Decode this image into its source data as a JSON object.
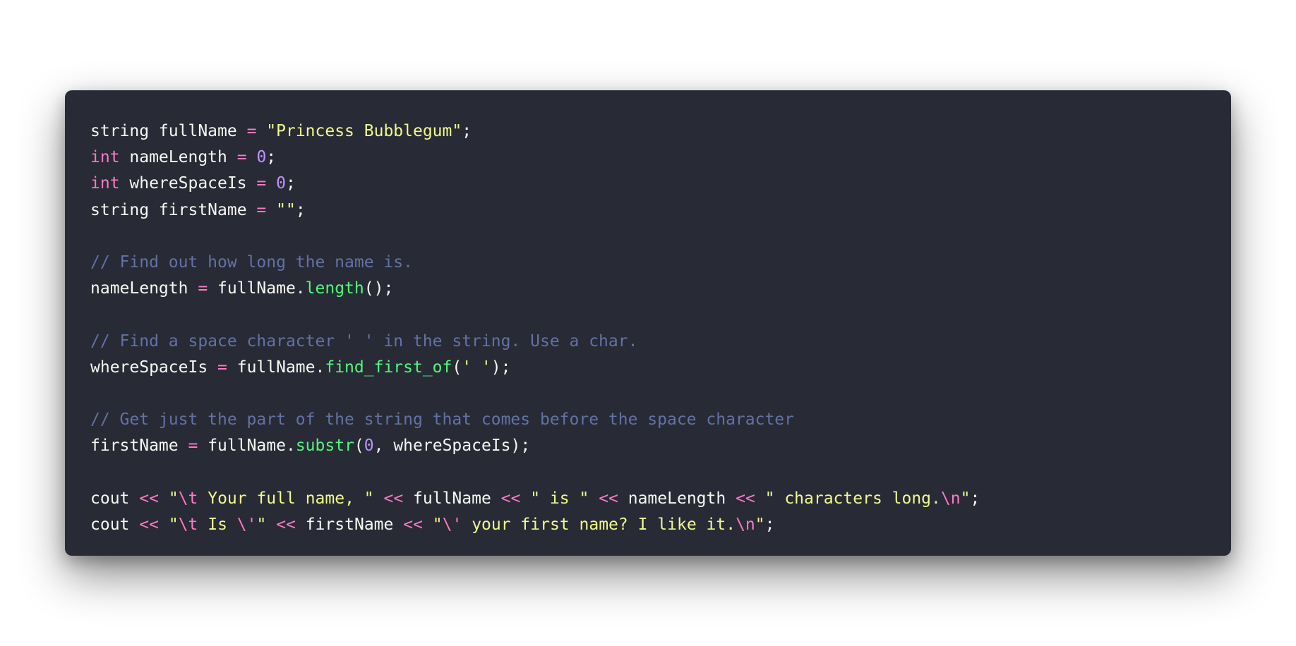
{
  "colors": {
    "background": "#ffffff",
    "editor_background": "#282a36",
    "plain": "#f8f8f2",
    "keyword": "#ff79c6",
    "operator": "#ff79c6",
    "string": "#f1fa8c",
    "escape": "#ff79c6",
    "number": "#bd93f9",
    "comment": "#6272a4",
    "function": "#50fa7b"
  },
  "code": {
    "language": "cpp",
    "lines": [
      [
        {
          "t": "plain",
          "v": "string fullName "
        },
        {
          "t": "op",
          "v": "="
        },
        {
          "t": "plain",
          "v": " "
        },
        {
          "t": "string",
          "v": "\"Princess Bubblegum\""
        },
        {
          "t": "plain",
          "v": ";"
        }
      ],
      [
        {
          "t": "keyword",
          "v": "int"
        },
        {
          "t": "plain",
          "v": " nameLength "
        },
        {
          "t": "op",
          "v": "="
        },
        {
          "t": "plain",
          "v": " "
        },
        {
          "t": "number",
          "v": "0"
        },
        {
          "t": "plain",
          "v": ";"
        }
      ],
      [
        {
          "t": "keyword",
          "v": "int"
        },
        {
          "t": "plain",
          "v": " whereSpaceIs "
        },
        {
          "t": "op",
          "v": "="
        },
        {
          "t": "plain",
          "v": " "
        },
        {
          "t": "number",
          "v": "0"
        },
        {
          "t": "plain",
          "v": ";"
        }
      ],
      [
        {
          "t": "plain",
          "v": "string firstName "
        },
        {
          "t": "op",
          "v": "="
        },
        {
          "t": "plain",
          "v": " "
        },
        {
          "t": "string",
          "v": "\"\""
        },
        {
          "t": "plain",
          "v": ";"
        }
      ],
      [],
      [
        {
          "t": "comment",
          "v": "// Find out how long the name is."
        }
      ],
      [
        {
          "t": "plain",
          "v": "nameLength "
        },
        {
          "t": "op",
          "v": "="
        },
        {
          "t": "plain",
          "v": " fullName."
        },
        {
          "t": "func",
          "v": "length"
        },
        {
          "t": "plain",
          "v": "();"
        }
      ],
      [],
      [
        {
          "t": "comment",
          "v": "// Find a space character ' ' in the string. Use a char."
        }
      ],
      [
        {
          "t": "plain",
          "v": "whereSpaceIs "
        },
        {
          "t": "op",
          "v": "="
        },
        {
          "t": "plain",
          "v": " fullName."
        },
        {
          "t": "func",
          "v": "find_first_of"
        },
        {
          "t": "plain",
          "v": "("
        },
        {
          "t": "string",
          "v": "' '"
        },
        {
          "t": "plain",
          "v": ");"
        }
      ],
      [],
      [
        {
          "t": "comment",
          "v": "// Get just the part of the string that comes before the space character"
        }
      ],
      [
        {
          "t": "plain",
          "v": "firstName "
        },
        {
          "t": "op",
          "v": "="
        },
        {
          "t": "plain",
          "v": " fullName."
        },
        {
          "t": "func",
          "v": "substr"
        },
        {
          "t": "plain",
          "v": "("
        },
        {
          "t": "number",
          "v": "0"
        },
        {
          "t": "plain",
          "v": ", whereSpaceIs);"
        }
      ],
      [],
      [
        {
          "t": "plain",
          "v": "cout "
        },
        {
          "t": "op",
          "v": "<<"
        },
        {
          "t": "plain",
          "v": " "
        },
        {
          "t": "string",
          "v": "\""
        },
        {
          "t": "escape",
          "v": "\\t"
        },
        {
          "t": "string",
          "v": " Your full name, \""
        },
        {
          "t": "plain",
          "v": " "
        },
        {
          "t": "op",
          "v": "<<"
        },
        {
          "t": "plain",
          "v": " fullName "
        },
        {
          "t": "op",
          "v": "<<"
        },
        {
          "t": "plain",
          "v": " "
        },
        {
          "t": "string",
          "v": "\" is \""
        },
        {
          "t": "plain",
          "v": " "
        },
        {
          "t": "op",
          "v": "<<"
        },
        {
          "t": "plain",
          "v": " nameLength "
        },
        {
          "t": "op",
          "v": "<<"
        },
        {
          "t": "plain",
          "v": " "
        },
        {
          "t": "string",
          "v": "\" characters long."
        },
        {
          "t": "escape",
          "v": "\\n"
        },
        {
          "t": "string",
          "v": "\""
        },
        {
          "t": "plain",
          "v": ";"
        }
      ],
      [
        {
          "t": "plain",
          "v": "cout "
        },
        {
          "t": "op",
          "v": "<<"
        },
        {
          "t": "plain",
          "v": " "
        },
        {
          "t": "string",
          "v": "\""
        },
        {
          "t": "escape",
          "v": "\\t"
        },
        {
          "t": "string",
          "v": " Is "
        },
        {
          "t": "escape",
          "v": "\\'"
        },
        {
          "t": "string",
          "v": "\""
        },
        {
          "t": "plain",
          "v": " "
        },
        {
          "t": "op",
          "v": "<<"
        },
        {
          "t": "plain",
          "v": " firstName "
        },
        {
          "t": "op",
          "v": "<<"
        },
        {
          "t": "plain",
          "v": " "
        },
        {
          "t": "string",
          "v": "\""
        },
        {
          "t": "escape",
          "v": "\\'"
        },
        {
          "t": "string",
          "v": " your first name? I like it."
        },
        {
          "t": "escape",
          "v": "\\n"
        },
        {
          "t": "string",
          "v": "\""
        },
        {
          "t": "plain",
          "v": ";"
        }
      ]
    ]
  }
}
